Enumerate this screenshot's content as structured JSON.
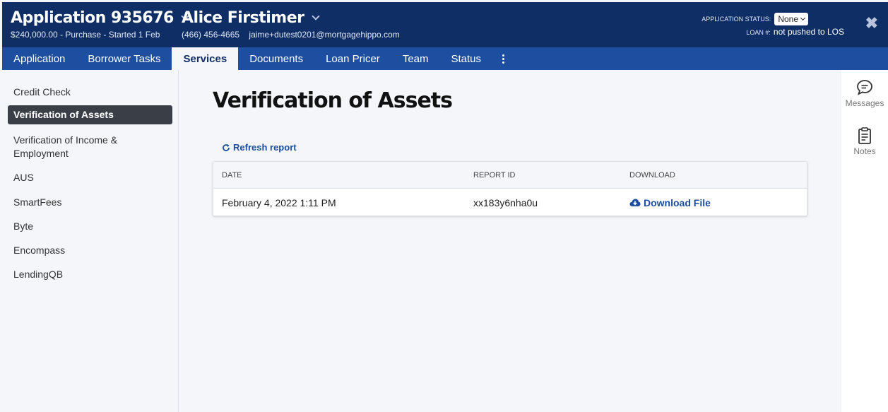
{
  "header": {
    "app_title": "Application 935676",
    "app_subtitle": "$240,000.00 - Purchase - Started 1 Feb",
    "borrower_name": "Alice Firstimer",
    "borrower_phone": "(466) 456-4665",
    "borrower_email": "jaime+dutest0201@mortgagehippo.com",
    "status_label": "APPLICATION STATUS:",
    "status_value": "None",
    "loan_label": "LOAN #:",
    "loan_value": "not pushed to LOS",
    "close_glyph": "✖"
  },
  "tabs": [
    {
      "label": "Application"
    },
    {
      "label": "Borrower Tasks"
    },
    {
      "label": "Services"
    },
    {
      "label": "Documents"
    },
    {
      "label": "Loan Pricer"
    },
    {
      "label": "Team"
    },
    {
      "label": "Status"
    }
  ],
  "sidebar": {
    "items": [
      {
        "label": "Credit Check"
      },
      {
        "label": "Verification of Assets"
      },
      {
        "label": "Verification of Income & Employment"
      },
      {
        "label": "AUS"
      },
      {
        "label": "SmartFees"
      },
      {
        "label": "Byte"
      },
      {
        "label": "Encompass"
      },
      {
        "label": "LendingQB"
      }
    ]
  },
  "main": {
    "title": "Verification of Assets",
    "refresh_label": "Refresh report",
    "table": {
      "columns": [
        "DATE",
        "REPORT ID",
        "DOWNLOAD"
      ],
      "rows": [
        {
          "date": "February 4, 2022 1:11 PM",
          "report_id": "xx183y6nha0u",
          "download_label": "Download File"
        }
      ]
    }
  },
  "rightbar": {
    "messages_label": "Messages",
    "notes_label": "Notes"
  },
  "colors": {
    "header_bg": "#0f2e66",
    "tabbar_bg": "#1d4ea0",
    "accent": "#1d4ea0",
    "sidebar_active_bg": "#3a3f47"
  }
}
